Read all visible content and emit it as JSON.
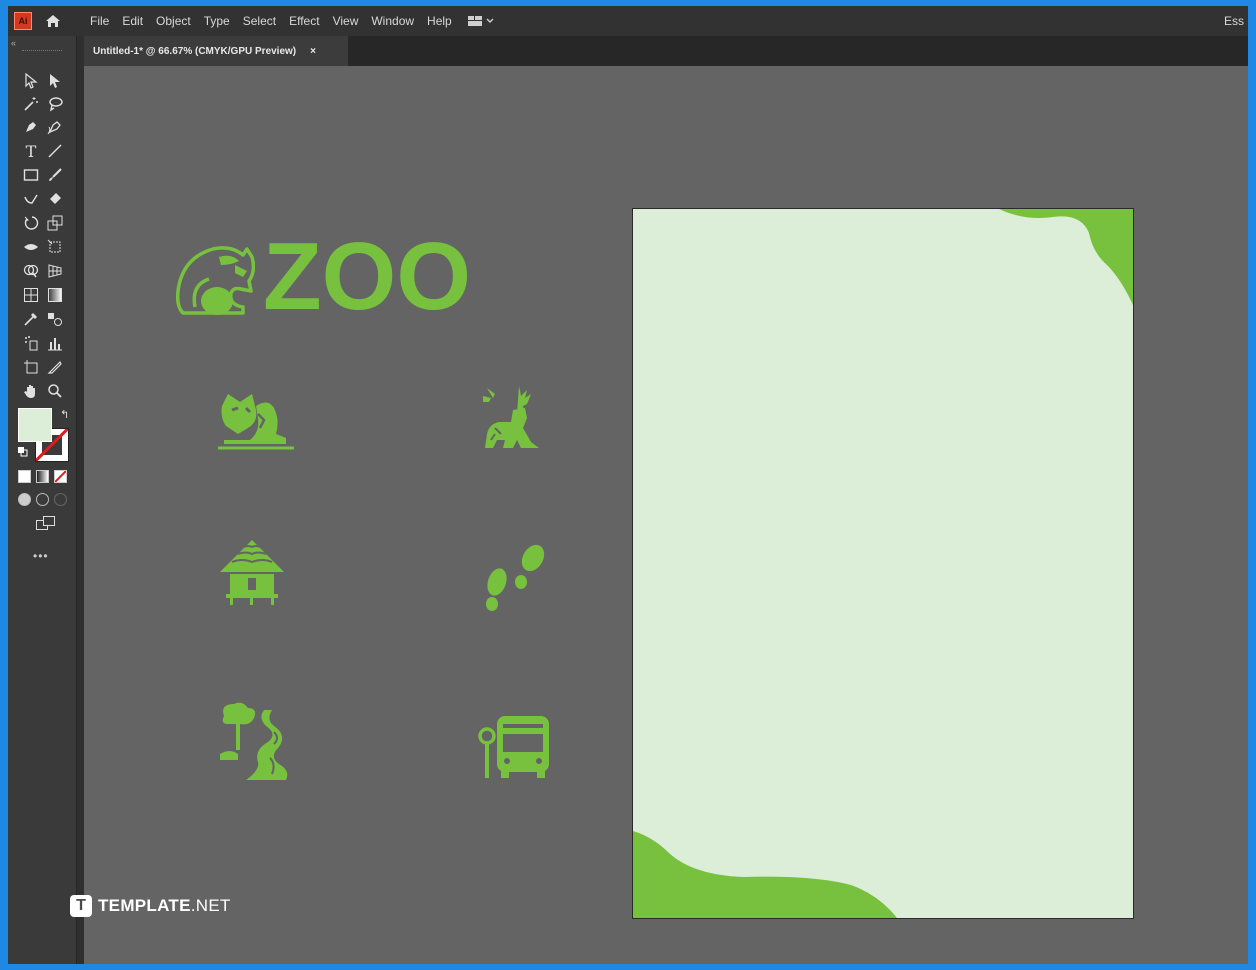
{
  "app": {
    "logo_text": "Ai",
    "menu": [
      "File",
      "Edit",
      "Object",
      "Type",
      "Select",
      "Effect",
      "View",
      "Window",
      "Help"
    ],
    "workspace_label": "Ess"
  },
  "document_tab": {
    "title": "Untitled-1* @ 66.67% (CMYK/GPU Preview)",
    "close_glyph": "×"
  },
  "toolbar": {
    "collapse_glyph": "«",
    "more_glyph": "•••",
    "fill_color": "#ddeed8",
    "stroke_color": "none",
    "tools": [
      "selection-tool",
      "direct-selection-tool",
      "magic-wand-tool",
      "lasso-tool",
      "pen-tool",
      "curvature-tool",
      "type-tool",
      "line-segment-tool",
      "rectangle-tool",
      "paintbrush-tool",
      "shaper-tool",
      "eraser-tool",
      "rotate-tool",
      "scale-tool",
      "width-tool",
      "free-transform-tool",
      "shape-builder-tool",
      "perspective-grid-tool",
      "mesh-tool",
      "gradient-tool",
      "eyedropper-tool",
      "blend-tool",
      "symbol-sprayer-tool",
      "column-graph-tool",
      "artboard-tool",
      "slice-tool",
      "hand-tool",
      "zoom-tool"
    ]
  },
  "canvas": {
    "logo_text": "ZOO",
    "accent_color": "#77c13f",
    "icons": [
      "fox-icon",
      "deer-icon",
      "hut-icon",
      "footprints-icon",
      "park-path-icon",
      "bus-stop-icon"
    ],
    "artboard_fill": "#ddeed8"
  },
  "watermark": {
    "badge": "T",
    "brand": "TEMPLATE",
    "suffix": ".NET"
  }
}
